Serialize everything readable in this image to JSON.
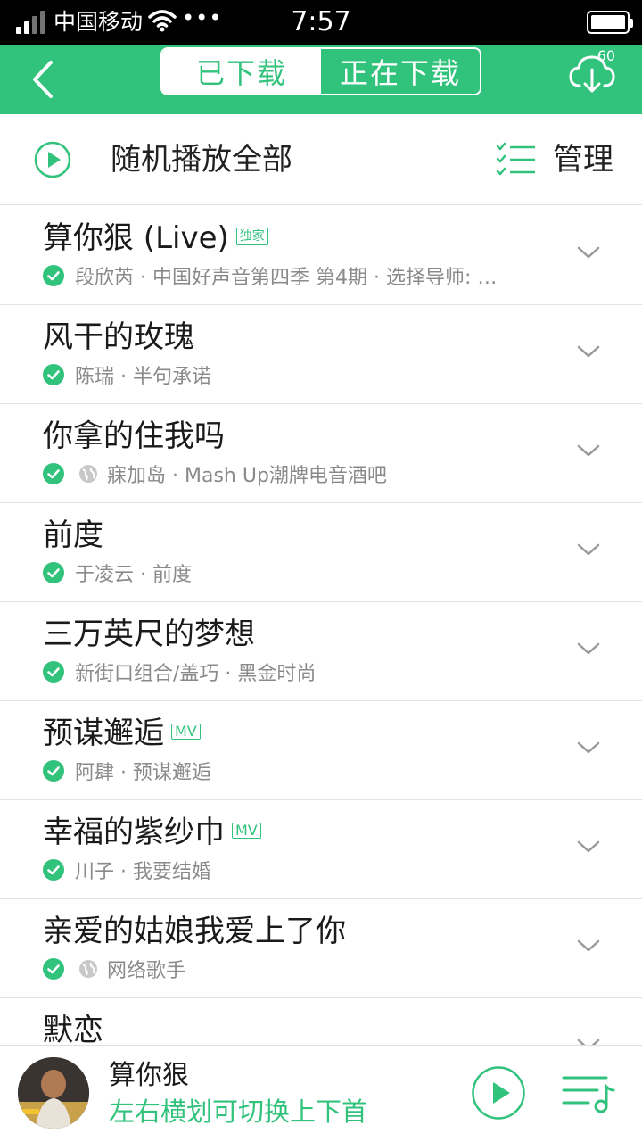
{
  "status_bar": {
    "carrier": "中国移动",
    "more": "•••",
    "time": "7:57"
  },
  "header": {
    "tabs": [
      {
        "label": "已下载",
        "active": true
      },
      {
        "label": "正在下载",
        "active": false
      }
    ],
    "download_count": "60",
    "accent": "#31c27c"
  },
  "toolbar": {
    "shuffle_label": "随机播放全部",
    "manage_label": "管理"
  },
  "songs": [
    {
      "title": "算你狠 (Live)",
      "tag": "独家",
      "subtitle": "段欣芮 · 中国好声音第四季 第4期 · 选择导师: …",
      "downloaded": true,
      "web": false
    },
    {
      "title": "风干的玫瑰",
      "tag": "",
      "subtitle": "陈瑞 · 半句承诺",
      "downloaded": true,
      "web": false
    },
    {
      "title": "你拿的住我吗",
      "tag": "",
      "subtitle": "寐加岛 · Mash Up潮牌电音酒吧",
      "downloaded": true,
      "web": true
    },
    {
      "title": "前度",
      "tag": "",
      "subtitle": "于凌云 · 前度",
      "downloaded": true,
      "web": false
    },
    {
      "title": "三万英尺的梦想",
      "tag": "",
      "subtitle": "新街口组合/盖巧 · 黑金时尚",
      "downloaded": true,
      "web": false
    },
    {
      "title": "预谋邂逅",
      "tag": "MV",
      "subtitle": "阿肆 · 预谋邂逅",
      "downloaded": true,
      "web": false
    },
    {
      "title": "幸福的紫纱巾",
      "tag": "MV",
      "subtitle": "川子 · 我要结婚",
      "downloaded": true,
      "web": false
    },
    {
      "title": "亲爱的姑娘我爱上了你",
      "tag": "",
      "subtitle": "网络歌手",
      "downloaded": true,
      "web": true
    },
    {
      "title": "默恋",
      "tag": "",
      "subtitle": "",
      "downloaded": true,
      "web": false
    }
  ],
  "player": {
    "title": "算你狠",
    "hint": "左右横划可切换上下首"
  }
}
